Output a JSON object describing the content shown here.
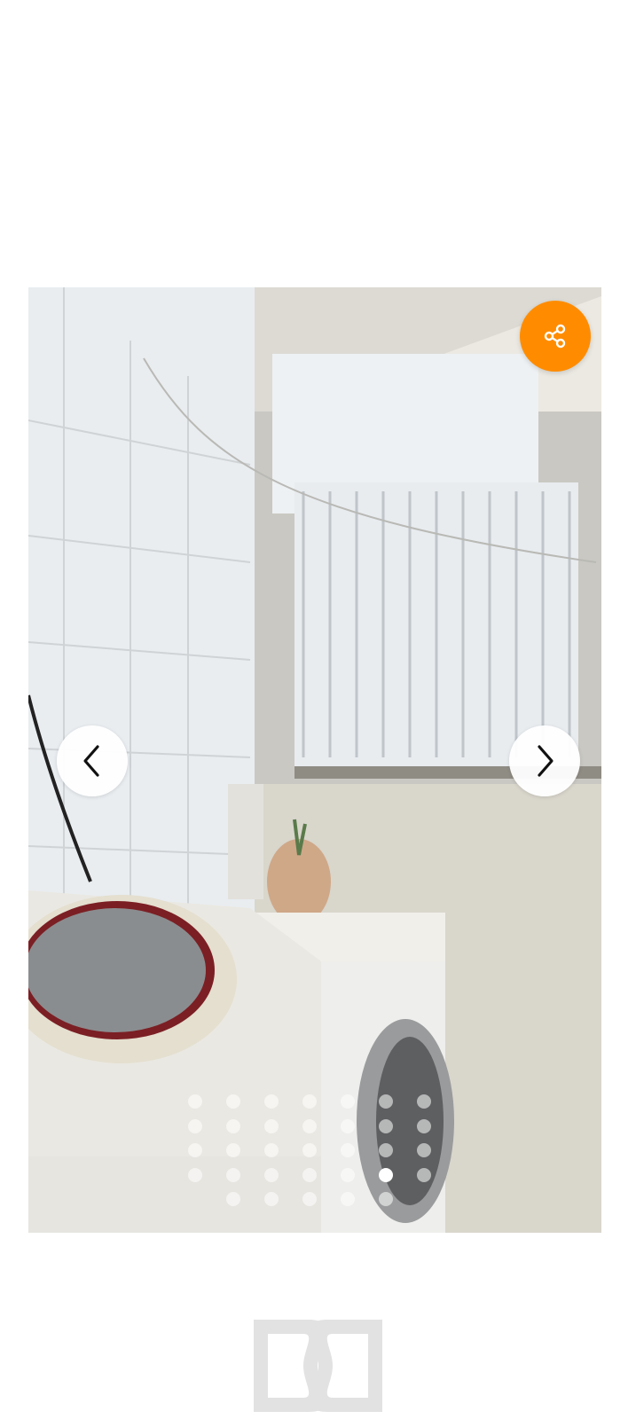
{
  "gallery": {
    "image_description_icon": "laundry-room-photo",
    "share_icon": "share-icon",
    "prev_icon": "chevron-left-icon",
    "next_icon": "chevron-right-icon",
    "accent_color": "#ff8c00",
    "dots": {
      "rows": [
        7,
        7,
        7,
        7,
        5
      ],
      "active_row": 3,
      "active_col": 5
    }
  },
  "footer": {
    "logo_icon": "dc-logo-icon"
  }
}
